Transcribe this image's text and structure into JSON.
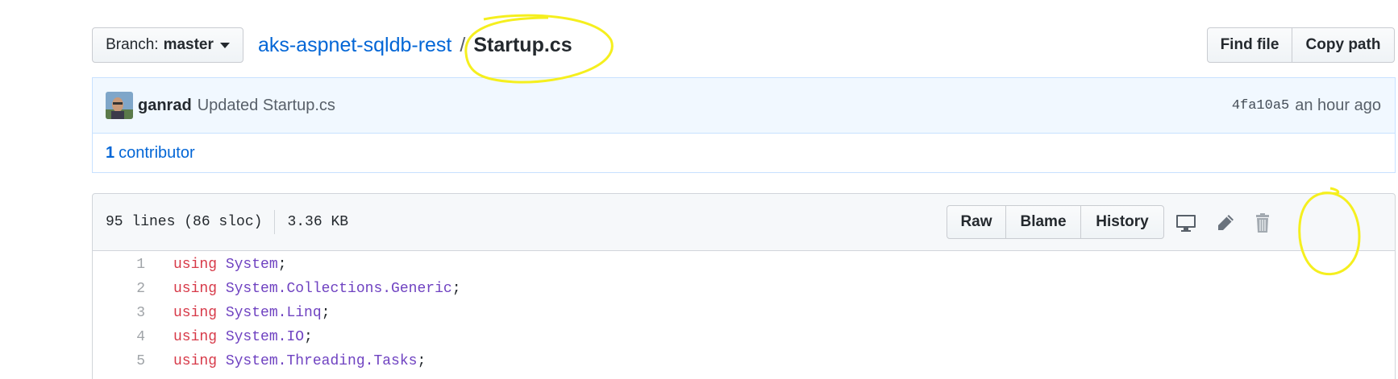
{
  "header": {
    "branch_label": "Branch:",
    "branch_name": "master",
    "repo_name": "aks-aspnet-sqldb-rest",
    "path_separator": "/",
    "file_name": "Startup.cs",
    "find_file_label": "Find file",
    "copy_path_label": "Copy path"
  },
  "commit": {
    "author": "ganrad",
    "message": "Updated Startup.cs",
    "sha": "4fa10a5",
    "time": "an hour ago"
  },
  "contributors": {
    "count": "1",
    "label": "contributor"
  },
  "file": {
    "lines_info": "95 lines (86 sloc)",
    "size": "3.36 KB",
    "raw_label": "Raw",
    "blame_label": "Blame",
    "history_label": "History",
    "icons": [
      "desktop-icon",
      "pencil-icon",
      "trash-icon"
    ]
  },
  "code_lines": [
    {
      "num": "1",
      "kw": "using",
      "ns": "System",
      "punct": ";"
    },
    {
      "num": "2",
      "kw": "using",
      "ns": "System.Collections.Generic",
      "punct": ";"
    },
    {
      "num": "3",
      "kw": "using",
      "ns": "System.Linq",
      "punct": ";"
    },
    {
      "num": "4",
      "kw": "using",
      "ns": "System.IO",
      "punct": ";"
    },
    {
      "num": "5",
      "kw": "using",
      "ns": "System.Threading.Tasks",
      "punct": ";"
    }
  ],
  "colors": {
    "link": "#0366d6",
    "keyword": "#d73a49",
    "namespace": "#6f42c1",
    "annotation": "#f5ef1e"
  }
}
